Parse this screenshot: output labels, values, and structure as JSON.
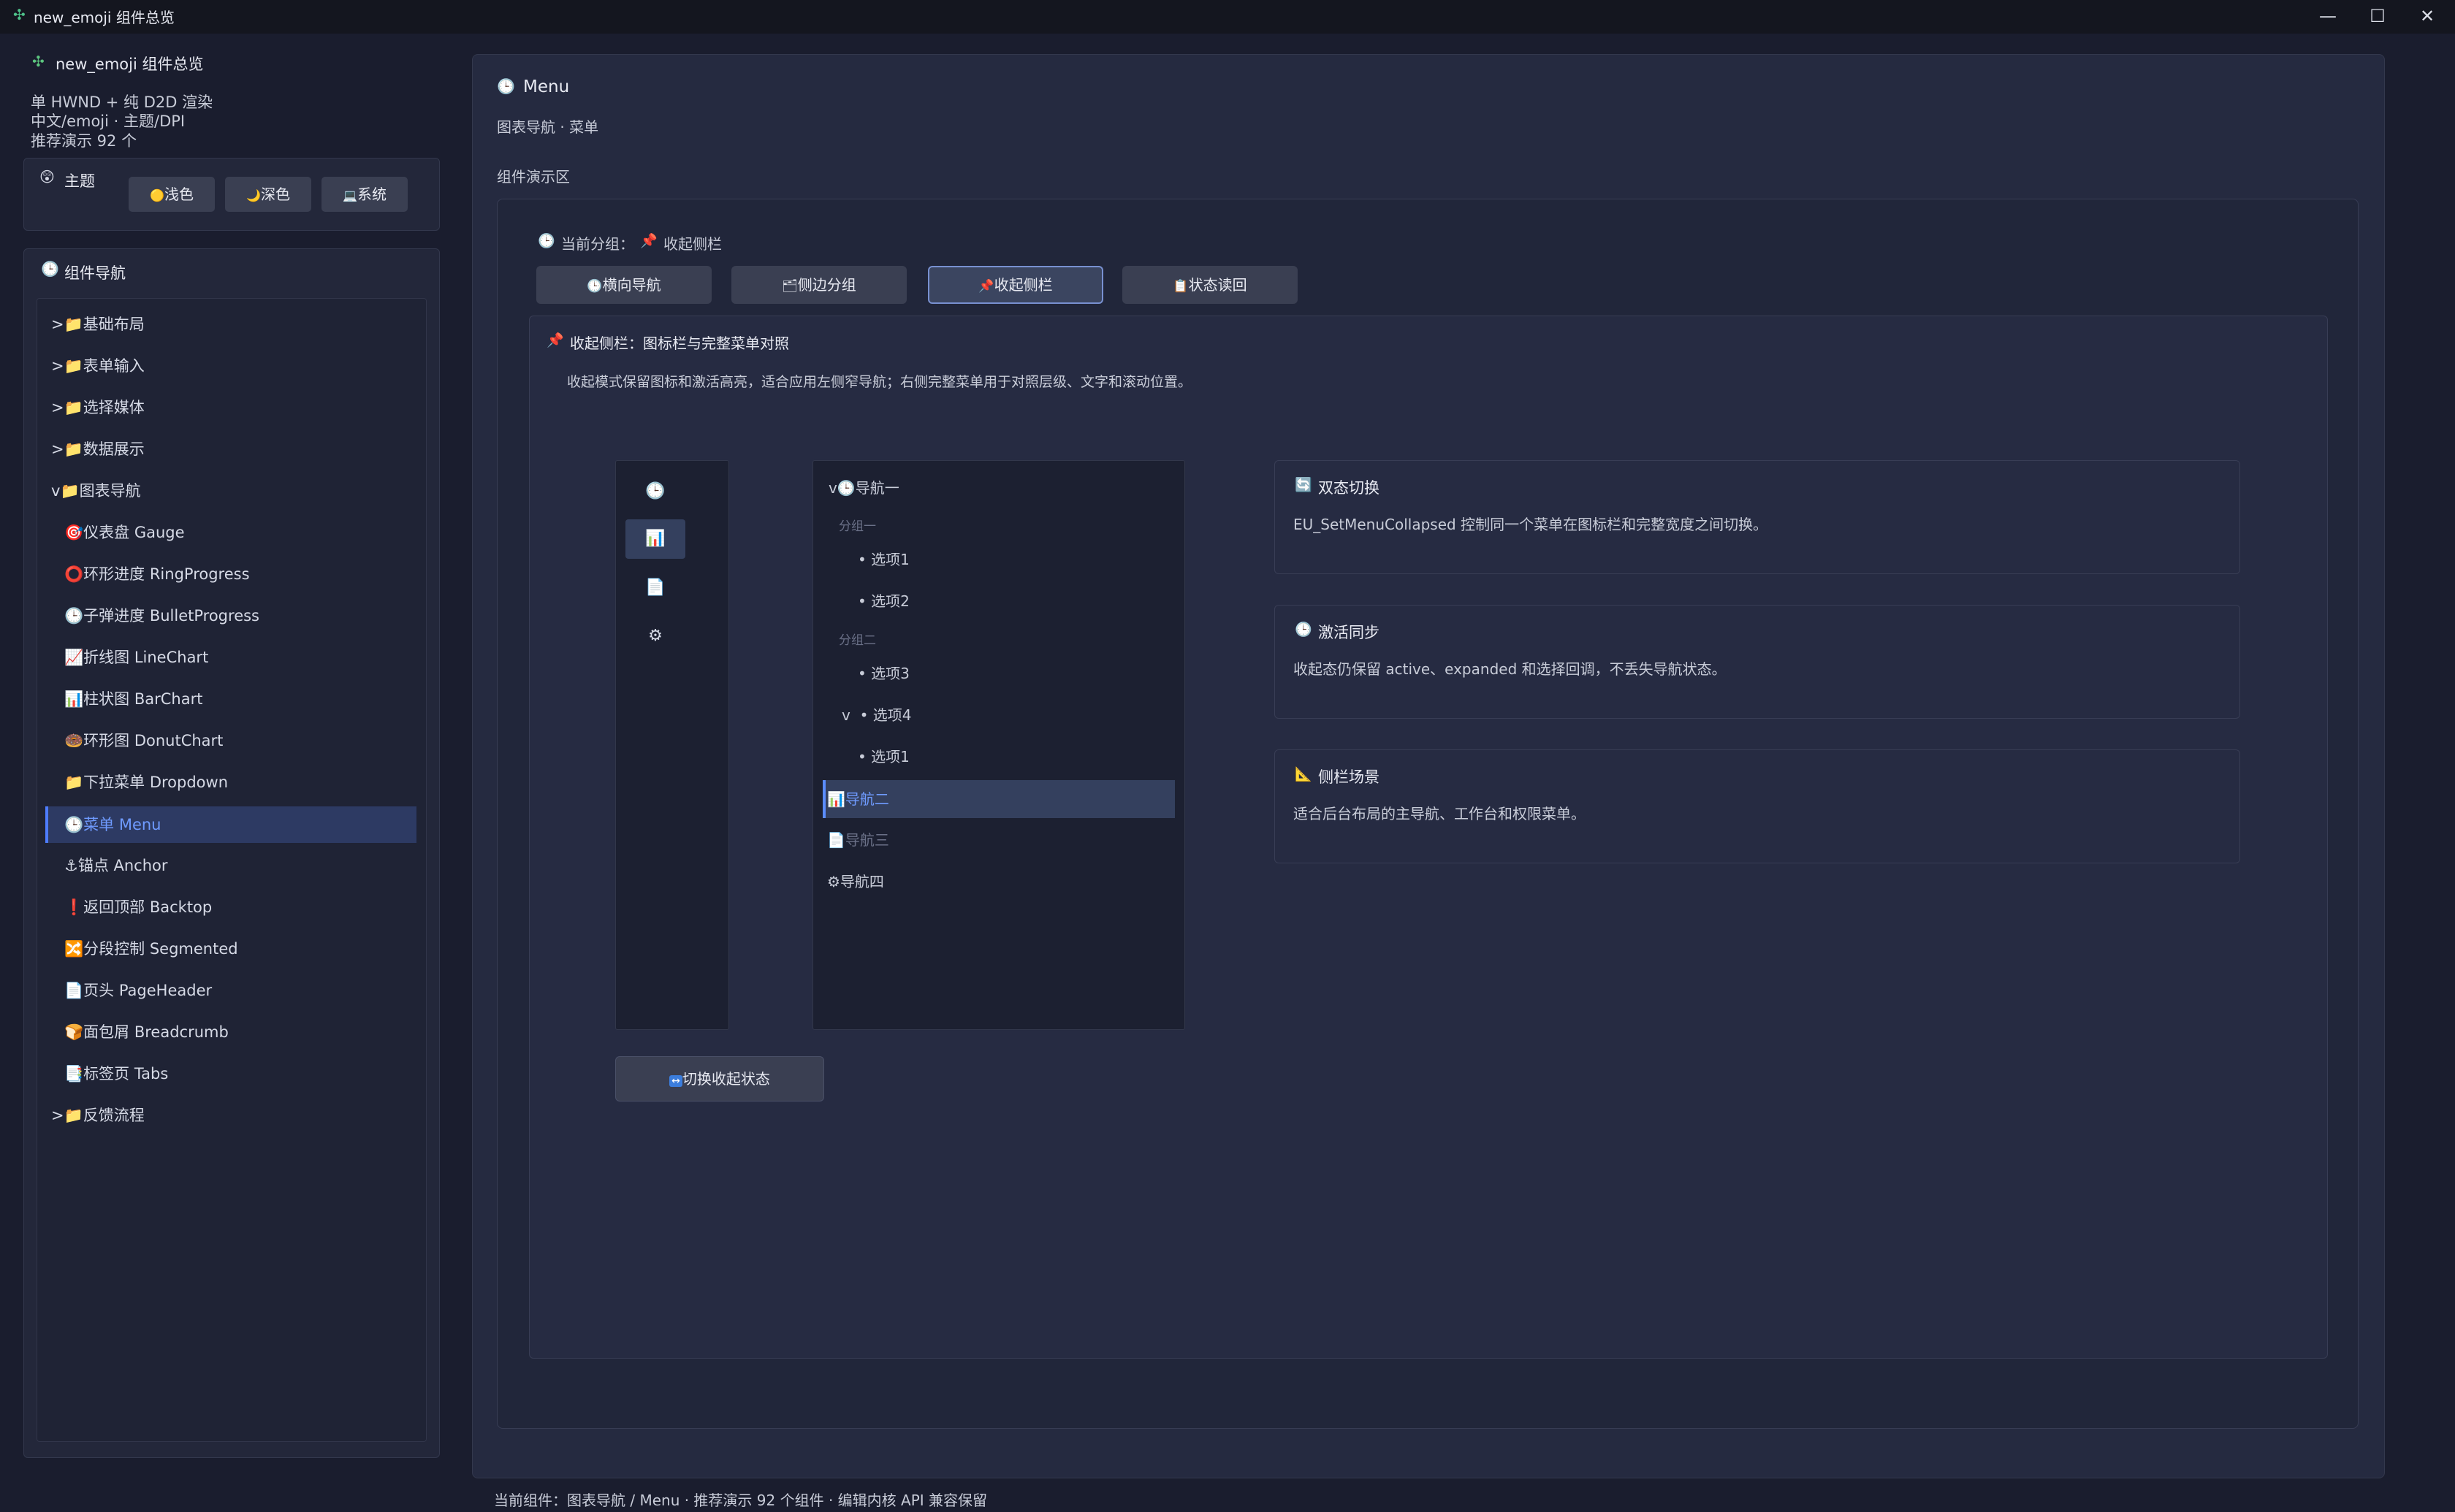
{
  "window": {
    "title": "new_emoji 组件总览",
    "app_icon": "sparkle-icon",
    "minimize_glyph": "—",
    "maximize_glyph": "☐",
    "close_glyph": "✕"
  },
  "sidebar": {
    "brand": "new_emoji 组件总览",
    "info_lines": [
      "单 HWND + 纯 D2D 渲染",
      "中文/emoji · 主题/DPI",
      "推荐演示 92 个"
    ],
    "theme": {
      "label": "主题",
      "icon": "palette-icon",
      "buttons": [
        {
          "label": "浅色",
          "icon": "sun-icon",
          "glyph": "🟡"
        },
        {
          "label": "深色",
          "icon": "moon-icon",
          "glyph": "🌙"
        },
        {
          "label": "系统",
          "icon": "laptop-icon",
          "glyph": "💻"
        }
      ]
    },
    "nav_title": "组件导航",
    "tree": [
      {
        "prefix": ">",
        "icon": "folder-icon",
        "label": "基础布局",
        "level": 0
      },
      {
        "prefix": ">",
        "icon": "folder-icon",
        "label": "表单输入",
        "level": 0
      },
      {
        "prefix": ">",
        "icon": "folder-icon",
        "label": "选择媒体",
        "level": 0
      },
      {
        "prefix": ">",
        "icon": "folder-icon",
        "label": "数据展示",
        "level": 0
      },
      {
        "prefix": "v",
        "icon": "folder-icon",
        "label": "图表导航",
        "level": 0
      },
      {
        "prefix": "",
        "icon": "gauge-icon",
        "label": "仪表盘 Gauge",
        "level": 1
      },
      {
        "prefix": "",
        "icon": "ring-icon",
        "label": "环形进度 RingProgress",
        "level": 1
      },
      {
        "prefix": "",
        "icon": "clock-icon",
        "label": "子弹进度 BulletProgress",
        "level": 1
      },
      {
        "prefix": "",
        "icon": "line-chart-icon",
        "label": "折线图 LineChart",
        "level": 1
      },
      {
        "prefix": "",
        "icon": "bar-chart-icon",
        "label": "柱状图 BarChart",
        "level": 1
      },
      {
        "prefix": "",
        "icon": "donut-icon",
        "label": "环形图 DonutChart",
        "level": 1
      },
      {
        "prefix": "",
        "icon": "folder-icon",
        "label": "下拉菜单 Dropdown",
        "level": 1
      },
      {
        "prefix": "",
        "icon": "clock-icon",
        "label": "菜单 Menu",
        "level": 1,
        "active": true
      },
      {
        "prefix": "",
        "icon": "anchor-icon",
        "label": "锚点 Anchor",
        "level": 1
      },
      {
        "prefix": "",
        "icon": "exclamation-icon",
        "label": "返回顶部 Backtop",
        "level": 1
      },
      {
        "prefix": "",
        "icon": "segmented-icon",
        "label": "分段控制 Segmented",
        "level": 1
      },
      {
        "prefix": "",
        "icon": "page-icon",
        "label": "页头 PageHeader",
        "level": 1
      },
      {
        "prefix": "",
        "icon": "breadcrumb-icon",
        "label": "面包屑 Breadcrumb",
        "level": 1
      },
      {
        "prefix": "",
        "icon": "document-icon",
        "label": "标签页 Tabs",
        "level": 1
      },
      {
        "prefix": ">",
        "icon": "folder-icon",
        "label": "反馈流程",
        "level": 0
      }
    ]
  },
  "main": {
    "title": "Menu",
    "subtitle": "图表导航 · 菜单",
    "demo_label": "组件演示区",
    "current_group_prefix": "当前分组：",
    "current_group": "收起侧栏",
    "tabs": [
      {
        "label": "横向导航",
        "icon": "clock-icon",
        "glyph": "🕒"
      },
      {
        "label": "侧边分组",
        "icon": "layers-icon",
        "glyph": "🗂"
      },
      {
        "label": "收起侧栏",
        "icon": "pin-icon",
        "glyph": "📌",
        "active": true
      },
      {
        "label": "状态读回",
        "icon": "clipboard-icon",
        "glyph": "📋"
      }
    ],
    "detail_title": "收起侧栏：图标栏与完整菜单对照",
    "detail_desc": "收起模式保留图标和激活高亮，适合应用左侧窄导航；右侧完整菜单用于对照层级、文字和滚动位置。",
    "icon_bar": [
      {
        "icon": "clock-icon",
        "glyph": "🕒"
      },
      {
        "icon": "bar-chart-icon",
        "glyph": "📊",
        "active": true
      },
      {
        "icon": "document-icon",
        "glyph": "📄"
      },
      {
        "icon": "gear-icon",
        "glyph": "⚙"
      }
    ],
    "menu": {
      "nav1": "导航一",
      "group1": "分组一",
      "opt1": "选项1",
      "opt2": "选项2",
      "group2": "分组二",
      "opt3": "选项3",
      "opt4": "选项4",
      "sub_opt1": "选项1",
      "nav2": "导航二",
      "nav3": "导航三",
      "nav4": "导航四",
      "expand_marker": "v",
      "bullet": "•"
    },
    "cards": [
      {
        "title": "双态切换",
        "icon": "sync-icon",
        "glyph": "🔄",
        "desc": "EU_SetMenuCollapsed 控制同一个菜单在图标栏和完整宽度之间切换。"
      },
      {
        "title": "激活同步",
        "icon": "clock-icon",
        "glyph": "🕒",
        "desc": "收起态仍保留 active、expanded 和选择回调，不丢失导航状态。"
      },
      {
        "title": "侧栏场景",
        "icon": "ruler-icon",
        "glyph": "📐",
        "desc": "适合后台布局的主导航、工作台和权限菜单。"
      }
    ],
    "toggle_button": "切换收起状态",
    "toggle_glyph": "↔"
  },
  "status_bar": "当前组件：图表导航 / Menu · 推荐演示 92 个组件 · 编辑内核 API 兼容保留",
  "colors": {
    "background": "#1a1d2e",
    "panel": "#252a40",
    "accent": "#4d7cff",
    "active_row": "#2d3a63"
  }
}
